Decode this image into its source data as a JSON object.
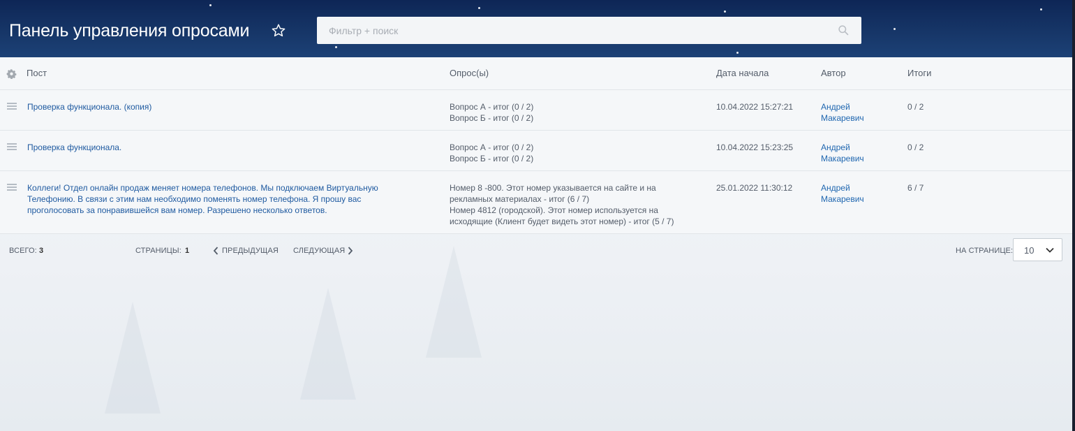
{
  "header": {
    "title": "Панель управления опросами",
    "search_placeholder": "Фильтр + поиск"
  },
  "columns": {
    "post": "Пост",
    "polls": "Опрос(ы)",
    "start_date": "Дата начала",
    "author": "Автор",
    "results": "Итоги"
  },
  "rows": [
    {
      "post": "Проверка функционала. (копия)",
      "polls": [
        "Вопрос А - итог (0 / 2)",
        "Вопрос Б - итог (0 / 2)"
      ],
      "date": "10.04.2022 15:27:21",
      "author_first": "Андрей",
      "author_last": "Макаревич",
      "results": "0 / 2"
    },
    {
      "post": "Проверка функционала.",
      "polls": [
        "Вопрос А - итог (0 / 2)",
        "Вопрос Б - итог (0 / 2)"
      ],
      "date": "10.04.2022 15:23:25",
      "author_first": "Андрей",
      "author_last": "Макаревич",
      "results": "0 / 2"
    },
    {
      "post_lines": [
        "Коллеги! Отдел онлайн продаж меняет номера телефонов. Мы подключаем Виртуальную",
        "Телефонию. В связи с этим нам необходимо поменять номер телефона. Я прошу вас",
        "проголосовать за понравившейся вам номер. Разрешено несколько ответов."
      ],
      "polls": [
        "Номер 8 -800. Этот номер указывается на сайте и на",
        "рекламных материалах - итог (6 / 7)",
        "Номер 4812 (городской). Этот номер используется на",
        "исходящие (Клиент будет видеть этот номер) - итог (5 / 7)"
      ],
      "date": "25.01.2022 11:30:12",
      "author_first": "Андрей",
      "author_last": "Макаревич",
      "results": "6 / 7"
    }
  ],
  "footer": {
    "total_label": "ВСЕГО:",
    "total_value": "3",
    "pages_label": "СТРАНИЦЫ:",
    "current_page": "1",
    "prev_label": "ПРЕДЫДУЩАЯ",
    "next_label": "СЛЕДУЮЩАЯ",
    "per_page_label": "НА СТРАНИЦЕ:",
    "per_page_value": "10"
  },
  "icons": {
    "favorite": "star-outline-icon",
    "search": "search-icon",
    "settings": "gear-icon",
    "drag": "drag-handle-icon",
    "prev": "chevron-left-icon",
    "next": "chevron-right-icon",
    "dropdown": "chevron-down-icon"
  },
  "colors": {
    "header_bg": "#173769",
    "link": "#1f5aa0",
    "text": "#535c69"
  }
}
